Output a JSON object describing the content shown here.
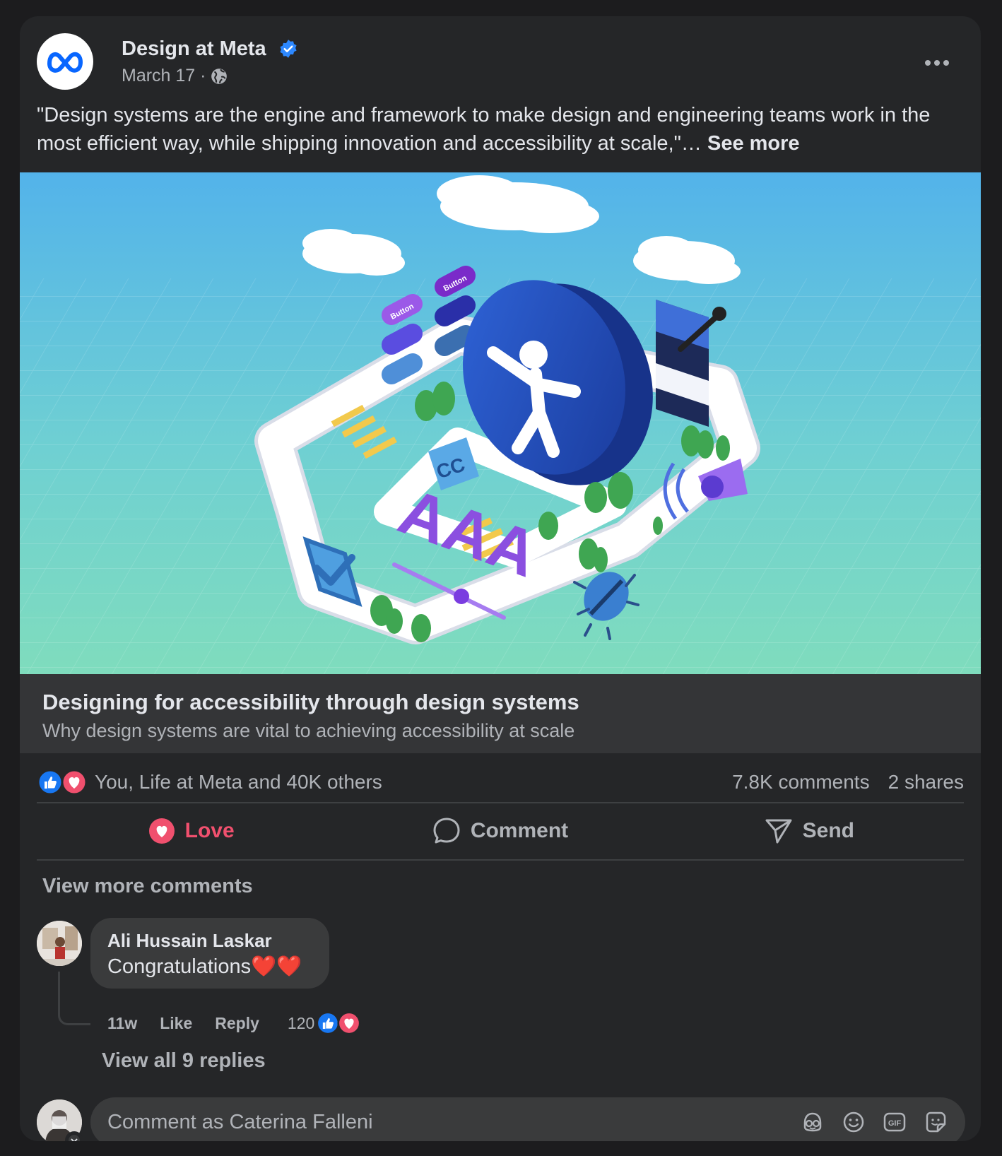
{
  "post": {
    "page_name": "Design at Meta",
    "date": "March 17 ·",
    "text": "\"Design systems are the engine and framework to make design and engineering teams work in the most efficient way, while shipping innovation and accessibility at scale,\"…",
    "see_more": "See more"
  },
  "hero": {
    "button_label": "Button",
    "cc_label": "CC",
    "aaa_label": "AAA"
  },
  "link_preview": {
    "title": "Designing for accessibility through design systems",
    "subtitle": "Why design systems are vital to achieving accessibility at scale"
  },
  "stats": {
    "reactions_text": "You, Life at Meta and 40K others",
    "comments": "7.8K comments",
    "shares": "2 shares"
  },
  "actions": {
    "love": "Love",
    "comment": "Comment",
    "send": "Send"
  },
  "comments": {
    "view_more": "View more comments",
    "items": [
      {
        "author": "Ali Hussain Laskar",
        "text": "Congratulations",
        "emoji": "❤️❤️",
        "time": "11w",
        "like": "Like",
        "reply": "Reply",
        "reaction_count": "120"
      }
    ],
    "view_replies": "View all 9 replies"
  },
  "composer": {
    "placeholder": "Comment as Caterina Falleni",
    "gif_label": "GIF"
  },
  "colors": {
    "background": "#1c1c1e",
    "card": "#252628",
    "love": "#f0506e",
    "like_blue": "#1877f2",
    "verified": "#2d88ff"
  },
  "icons": [
    "meta-logo-icon",
    "verified-badge-icon",
    "globe-icon",
    "more-options-icon",
    "like-reaction-icon",
    "love-reaction-icon",
    "heart-icon",
    "comment-icon",
    "send-icon",
    "chevron-down-icon",
    "avatar-sticker-icon",
    "emoji-icon",
    "gif-icon",
    "sticker-icon"
  ]
}
